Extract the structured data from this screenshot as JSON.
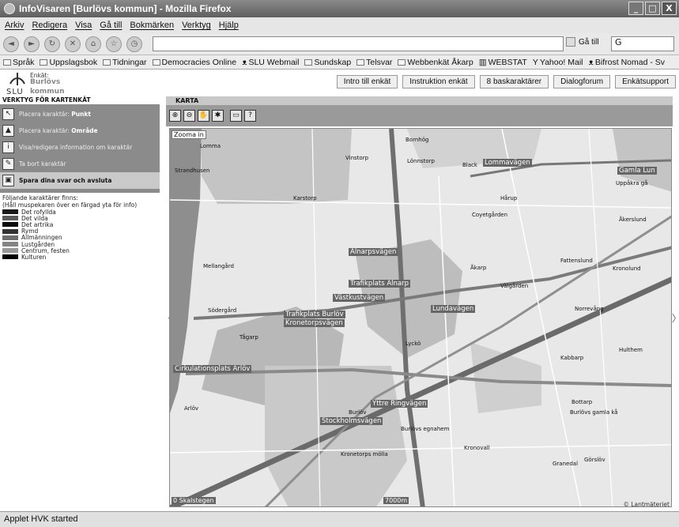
{
  "window": {
    "title": "InfoVisaren [Burlövs kommun] - Mozilla Firefox"
  },
  "menu": [
    "Arkiv",
    "Redigera",
    "Visa",
    "Gå till",
    "Bokmärken",
    "Verktyg",
    "Hjälp"
  ],
  "toolbar": {
    "go_label": "Gå till",
    "search_value": "G"
  },
  "bookmarks": [
    "Språk",
    "Uppslagsbok",
    "Tidningar",
    "Democracies Online",
    "SLU Webmail",
    "Sundskap",
    "Telsvar",
    "Webbenkät Åkarp",
    "WEBSTAT",
    "Yahoo! Mail",
    "Bifrost Nomad - Sv"
  ],
  "logo": {
    "top": "Enkät:",
    "place": "Burlövs",
    "org": "SLU",
    "kommun": "kommun"
  },
  "header_buttons": [
    "Intro till enkät",
    "Instruktion enkät",
    "8 baskaraktärer",
    "Dialogforum",
    "Enkätsupport"
  ],
  "left_panel": {
    "heading": "VERKTYG FÖR KARTENKÄT",
    "tools": [
      {
        "prefix": "Placera karaktär: ",
        "bold": "Punkt"
      },
      {
        "prefix": "Placera karaktär: ",
        "bold": "Område"
      },
      {
        "prefix": "Visa/redigera information om karaktär",
        "bold": ""
      },
      {
        "prefix": "Ta bort karaktär",
        "bold": ""
      },
      {
        "prefix": "Spara dina svar och avsluta",
        "bold": ""
      }
    ],
    "legend_intro_1": "Följande karaktärer finns:",
    "legend_intro_2": "(Håll muspekaren över en färgad yta för info)",
    "legend": [
      {
        "label": "Det rofyllda",
        "color": "#1a1a1a"
      },
      {
        "label": "Det vilda",
        "color": "#5a5a5a"
      },
      {
        "label": "Det artrika",
        "color": "#0d0d0d"
      },
      {
        "label": "Rymd",
        "color": "#333333"
      },
      {
        "label": "Allmänningen",
        "color": "#6e6e6e"
      },
      {
        "label": "Lustgården",
        "color": "#848484"
      },
      {
        "label": "Centrum, festen",
        "color": "#999999"
      },
      {
        "label": "Kulturen",
        "color": "#000000"
      }
    ]
  },
  "map": {
    "heading": "KARTA",
    "zoom_label": "Zooma in",
    "scale_left": "0 Skalstegen",
    "scale_right": "7000m",
    "copyright": "© Lantmäteriet",
    "places": [
      "Lomma",
      "Bornhög",
      "Vinstorp",
      "Lönnstorp",
      "Black",
      "Strandhusen",
      "Karstorp",
      "Hårup",
      "Coyetgården",
      "Åkerslund",
      "Mellangård",
      "Åkarp",
      "Fattenslund",
      "Kronolund",
      "Välgården",
      "Södergård",
      "Norrevång",
      "Lyckö",
      "Kabbarp",
      "Hulthem",
      "Tågarp",
      "Arlöv",
      "Burlöv",
      "Bottarp",
      "Burlövs egnahem",
      "Kronovall",
      "Kronetorps mölla",
      "Granedal",
      "Görslöv",
      "Uppåkra gå",
      "Burlövs gamla kå"
    ],
    "road_labels": [
      "Lommavägen",
      "Gamla Lun",
      "Alnarpsvägen",
      "Trafikplats Alnarp",
      "Västkustvägen",
      "Lundavägen",
      "Trafikplats Burlöv",
      "Kronetorpsvägen",
      "Cirkulationsplats Arlöv",
      "Yttre Ringvägen",
      "Stockholmsvägen"
    ]
  },
  "status": {
    "text": "Applet HVK started"
  }
}
